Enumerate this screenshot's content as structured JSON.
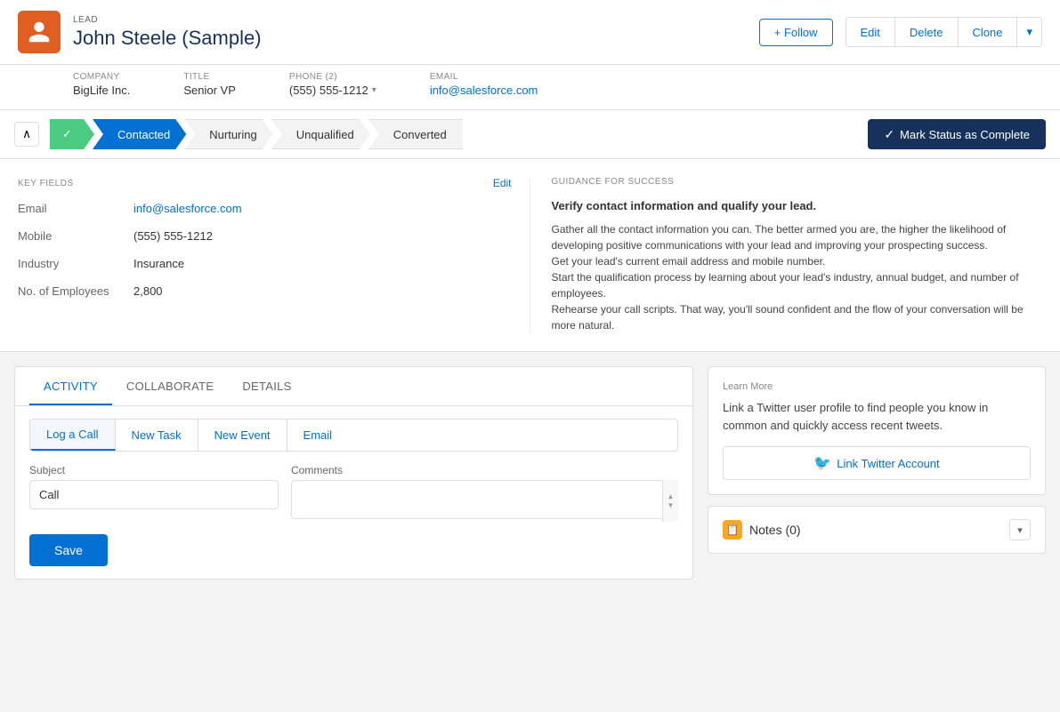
{
  "header": {
    "record_type": "LEAD",
    "name": "John Steele (Sample)",
    "follow_label": "+ Follow",
    "edit_label": "Edit",
    "delete_label": "Delete",
    "clone_label": "Clone"
  },
  "meta": {
    "company_label": "COMPANY",
    "company_value": "BigLife Inc.",
    "title_label": "TITLE",
    "title_value": "Senior VP",
    "phone_label": "PHONE (2)",
    "phone_value": "(555) 555-1212",
    "email_label": "EMAIL",
    "email_value": "info@salesforce.com"
  },
  "stages": [
    {
      "label": "✓",
      "name": "completed-check"
    },
    {
      "label": "Contacted",
      "name": "contacted"
    },
    {
      "label": "Nurturing",
      "name": "nurturing"
    },
    {
      "label": "Unqualified",
      "name": "unqualified"
    },
    {
      "label": "Converted",
      "name": "converted"
    }
  ],
  "mark_status_label": "Mark Status as Complete",
  "key_fields": {
    "section_title": "KEY FIELDS",
    "edit_label": "Edit",
    "fields": [
      {
        "label": "Email",
        "value": "info@salesforce.com",
        "is_link": true
      },
      {
        "label": "Mobile",
        "value": "(555) 555-1212",
        "is_link": false
      },
      {
        "label": "Industry",
        "value": "Insurance",
        "is_link": false
      },
      {
        "label": "No. of Employees",
        "value": "2,800",
        "is_link": false
      }
    ]
  },
  "guidance": {
    "section_title": "GUIDANCE FOR SUCCESS",
    "title": "Verify contact information and qualify your lead.",
    "paragraphs": [
      "Gather all the contact information you can. The better armed you are, the higher the likelihood of developing positive communications with your lead and improving your prospecting success.",
      "Get your lead's current email address and mobile number.",
      "Start the qualification process by learning about your lead's industry, annual budget, and number of employees.",
      "Rehearse your call scripts. That way, you'll sound confident and the flow of your conversation will be more natural."
    ]
  },
  "activity": {
    "tabs": [
      {
        "label": "ACTIVITY",
        "active": true
      },
      {
        "label": "COLLABORATE",
        "active": false
      },
      {
        "label": "DETAILS",
        "active": false
      }
    ],
    "action_tabs": [
      {
        "label": "Log a Call",
        "active": true
      },
      {
        "label": "New Task",
        "active": false
      },
      {
        "label": "New Event",
        "active": false
      },
      {
        "label": "Email",
        "active": false
      }
    ],
    "subject_label": "Subject",
    "subject_value": "Call",
    "comments_label": "Comments",
    "save_label": "Save"
  },
  "twitter": {
    "learn_more": "Learn More",
    "desc": "Link a Twitter user profile to find people you know in common and quickly access recent tweets.",
    "btn_label": "Link Twitter Account"
  },
  "notes": {
    "title": "Notes (0)"
  }
}
